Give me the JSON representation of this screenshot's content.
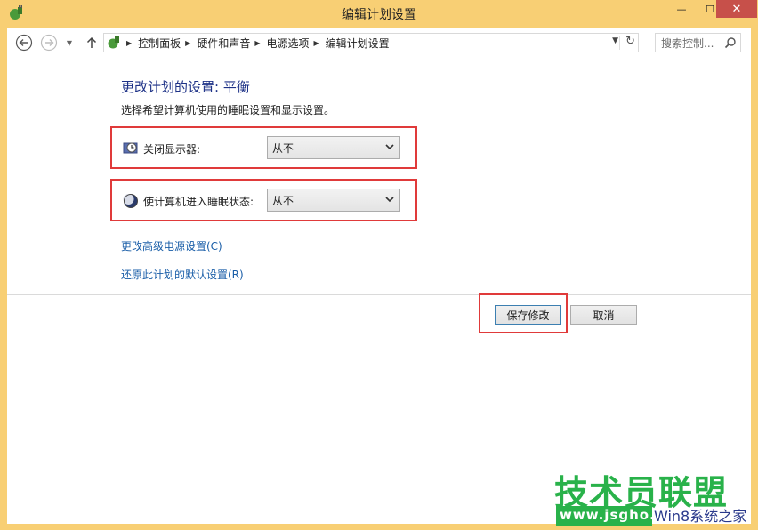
{
  "window": {
    "title": "编辑计划设置",
    "min_glyph": "—",
    "max_glyph": "☐",
    "close_glyph": "✕"
  },
  "nav": {
    "breadcrumbs": [
      "控制面板",
      "硬件和声音",
      "电源选项",
      "编辑计划设置"
    ],
    "search_placeholder": "搜索控制...",
    "icons": [
      "back-arrow-icon",
      "forward-arrow-icon",
      "up-arrow-icon",
      "refresh-icon",
      "search-icon"
    ]
  },
  "content": {
    "heading": "更改计划的设置: 平衡",
    "subheading": "选择希望计算机使用的睡眠设置和显示设置。",
    "settings": [
      {
        "label": "关闭显示器:",
        "value": "从不",
        "icon": "monitor-clock-icon"
      },
      {
        "label": "使计算机进入睡眠状态:",
        "value": "从不",
        "icon": "moon-icon"
      }
    ],
    "links": {
      "advanced": "更改高级电源设置(C)",
      "restore": "还原此计划的默认设置(R)"
    },
    "buttons": {
      "save": "保存修改",
      "cancel": "取消"
    }
  },
  "watermark": {
    "title": "技术员联盟",
    "url": "www.jsgho.com",
    "sub": "Win8系统之家"
  },
  "colors": {
    "window_frame": "#f8cf74",
    "heading": "#1e3287",
    "link": "#1a5ea8",
    "highlight_box": "#e03a3a",
    "watermark_green": "#29b24a"
  }
}
